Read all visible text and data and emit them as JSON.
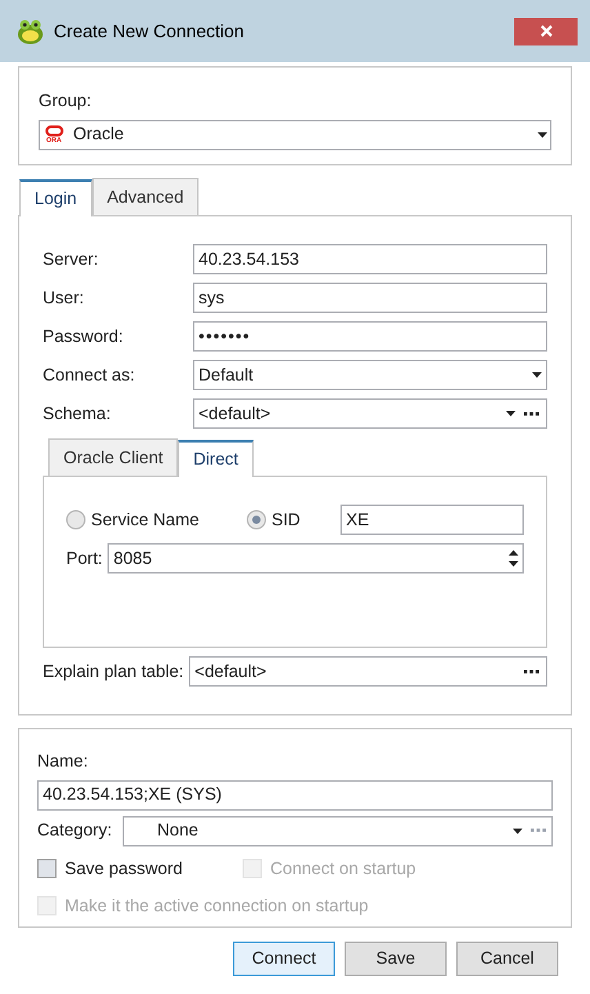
{
  "window": {
    "title": "Create New Connection"
  },
  "group": {
    "label": "Group:",
    "logo_text": "ORA",
    "value": "Oracle"
  },
  "tabs": [
    {
      "label": "Login",
      "selected": true
    },
    {
      "label": "Advanced",
      "selected": false
    }
  ],
  "login_fields": [
    {
      "kind": "text",
      "label": "Server:",
      "value": "40.23.54.153"
    },
    {
      "kind": "text",
      "label": "User:",
      "value": "sys"
    },
    {
      "kind": "password",
      "label": "Password:",
      "value": "•••••••"
    },
    {
      "kind": "dropdown",
      "label": "Connect as:",
      "value": "Default"
    },
    {
      "kind": "dropdown_browse",
      "label": "Schema:",
      "value": "<default>"
    }
  ],
  "connection_tabs": [
    {
      "label": "Oracle Client",
      "selected": false
    },
    {
      "label": "Direct",
      "selected": true
    }
  ],
  "direct": {
    "options": [
      {
        "label": "Service Name",
        "selected": false
      },
      {
        "label": "SID",
        "selected": true
      }
    ],
    "sid_value": "XE",
    "port": {
      "label": "Port:",
      "value": "8085"
    }
  },
  "explain_plan": {
    "label": "Explain plan table:",
    "value": "<default>"
  },
  "name": {
    "label": "Name:",
    "value": "40.23.54.153;XE (SYS)"
  },
  "category": {
    "label": "Category:",
    "value": "None"
  },
  "options": [
    {
      "label": "Save password",
      "checked": false,
      "disabled": false
    },
    {
      "label": "Connect on startup",
      "checked": false,
      "disabled": true
    },
    {
      "label": "Make it the active connection on startup",
      "checked": false,
      "disabled": true
    }
  ],
  "buttons": [
    {
      "label": "Connect",
      "default": true
    },
    {
      "label": "Save",
      "default": false
    },
    {
      "label": "Cancel",
      "default": false
    }
  ]
}
